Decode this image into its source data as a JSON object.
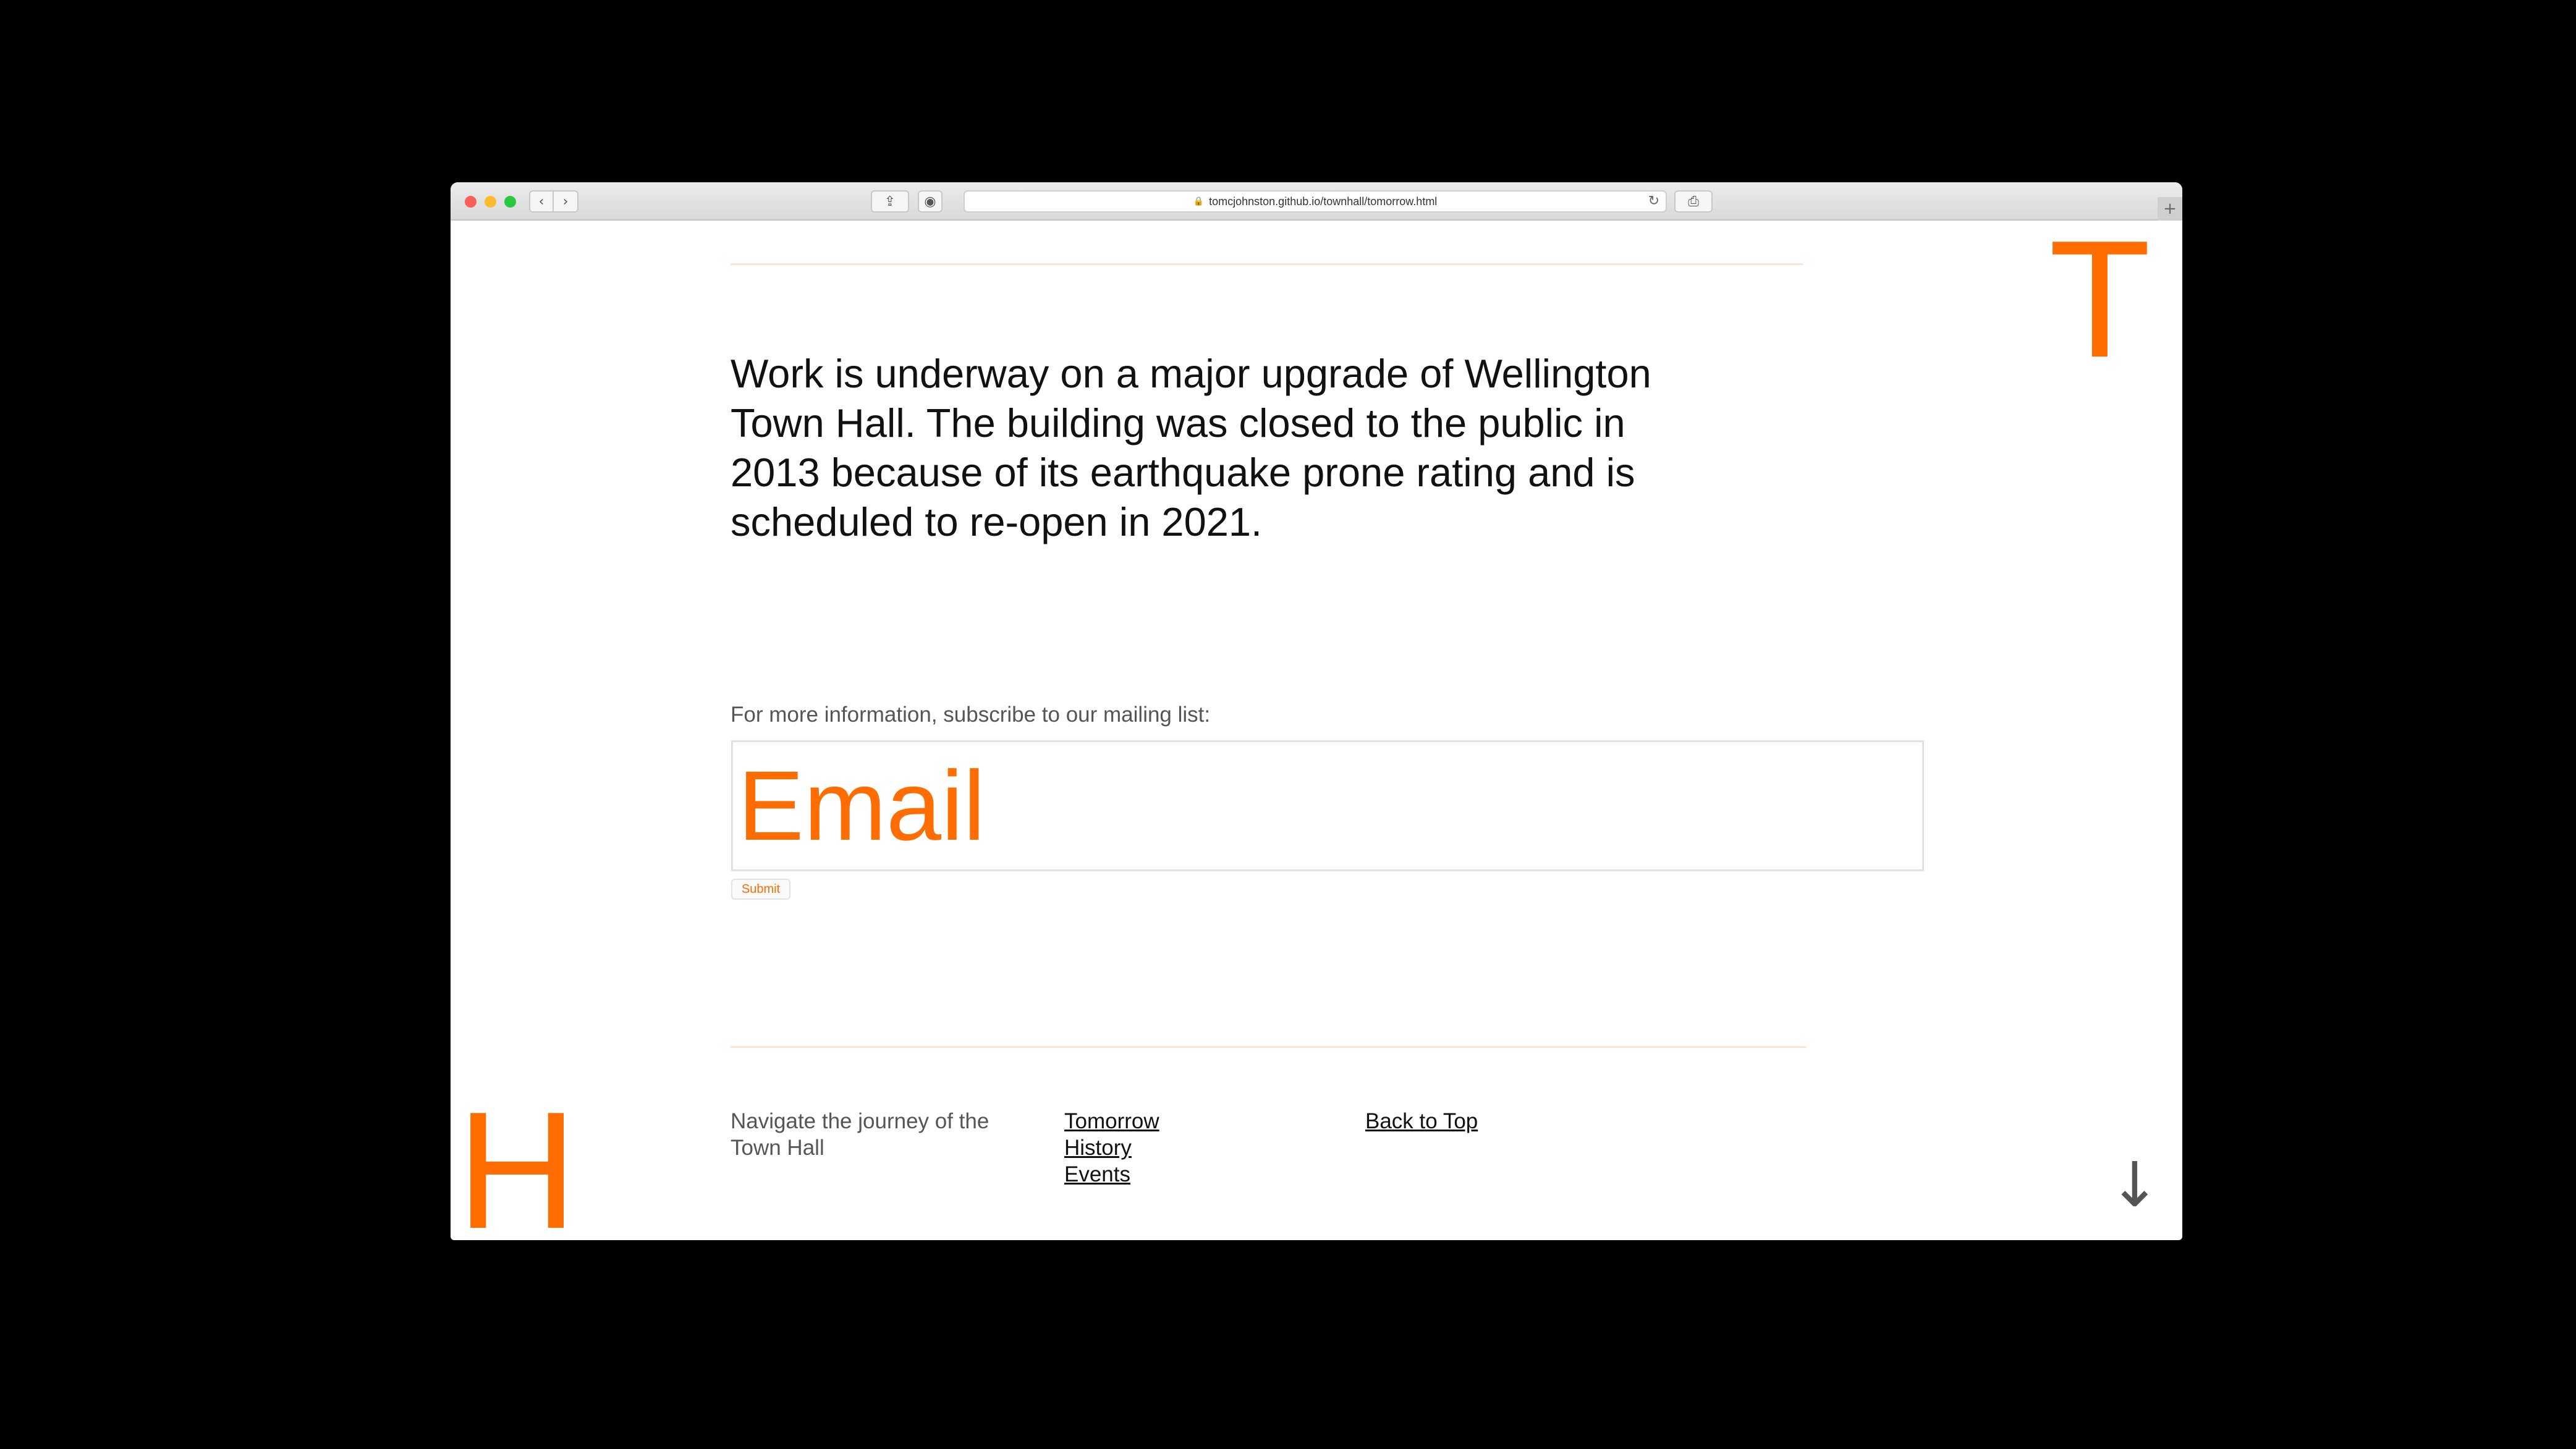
{
  "browser": {
    "url": "tomcjohnston.github.io/townhall/tomorrow.html",
    "icons": [
      "close-icon",
      "minimize-icon",
      "zoom-icon",
      "chevron-left-icon",
      "chevron-right-icon",
      "share-icon",
      "extension-icon",
      "lock-icon",
      "reload-icon",
      "print-icon",
      "plus-icon"
    ]
  },
  "page": {
    "corner_top": "T",
    "corner_bottom": "H",
    "lead": "Work is underway on a major upgrade of Wellington Town Hall. The building was closed to the public in 2013 because of its earthquake prone rating and is scheduled to re-open in 2021.",
    "subscribe_label": "For more information, subscribe to our mailing list:",
    "email_placeholder": "Email",
    "submit_label": "Submit"
  },
  "footer": {
    "intro": "Navigate the journey of the Town Hall",
    "nav": [
      "Tomorrow",
      "History",
      "Events"
    ],
    "back_to_top": "Back to Top"
  },
  "colors": {
    "accent": "#ff6d00",
    "rule": "#fde3d5",
    "background": "#000000"
  }
}
